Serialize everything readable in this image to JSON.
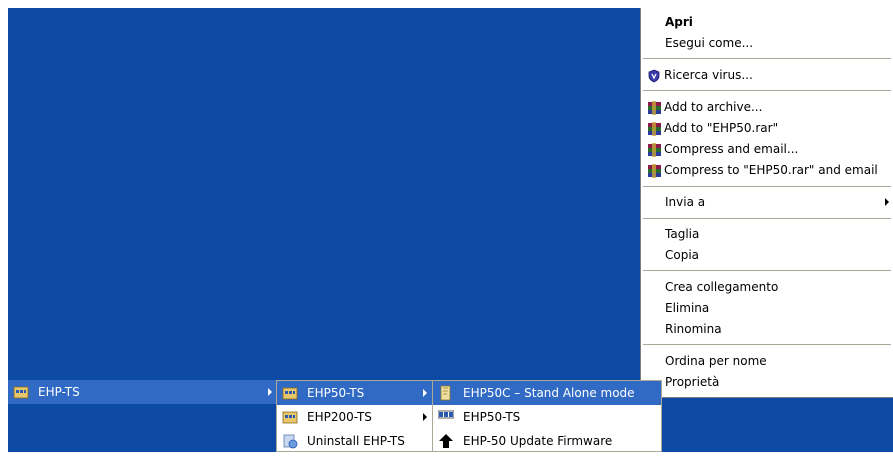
{
  "context_menu": {
    "items": [
      {
        "label": "Apri",
        "bold": true
      },
      {
        "label": "Esegui come..."
      },
      {
        "label": "Ricerca virus...",
        "icon": "shield-icon"
      },
      {
        "label": "Add to archive...",
        "icon": "winrar-icon"
      },
      {
        "label": "Add to \"EHP50.rar\"",
        "icon": "winrar-icon"
      },
      {
        "label": "Compress and email...",
        "icon": "winrar-icon"
      },
      {
        "label": "Compress to \"EHP50.rar\" and email",
        "icon": "winrar-icon"
      },
      {
        "label": "Invia a",
        "submenu": true
      },
      {
        "label": "Taglia"
      },
      {
        "label": "Copia"
      },
      {
        "label": "Crea collegamento"
      },
      {
        "label": "Elimina"
      },
      {
        "label": "Rinomina"
      },
      {
        "label": "Ordina per nome"
      },
      {
        "label": "Proprietà"
      }
    ]
  },
  "start_menu_level1": {
    "items": [
      {
        "label": "EHP-TS",
        "icon": "program-group-icon",
        "highlighted": true,
        "submenu": true
      }
    ]
  },
  "start_menu_level2": {
    "items": [
      {
        "label": "EHP50-TS",
        "icon": "program-group-icon",
        "highlighted": true,
        "submenu": true
      },
      {
        "label": "EHP200-TS",
        "icon": "program-group-icon",
        "submenu": true
      },
      {
        "label": "Uninstall EHP-TS",
        "icon": "uninstall-icon"
      }
    ]
  },
  "start_menu_level3": {
    "items": [
      {
        "label": "EHP50C – Stand Alone mode",
        "icon": "pencil-app-icon",
        "highlighted": true
      },
      {
        "label": "EHP50-TS",
        "icon": "app-window-icon"
      },
      {
        "label": "EHP-50 Update Firmware",
        "icon": "upload-arrow-icon"
      }
    ]
  },
  "colors": {
    "desktop": "#0d4aa5",
    "highlight": "#316ac5",
    "menu_bg": "#ffffff"
  }
}
